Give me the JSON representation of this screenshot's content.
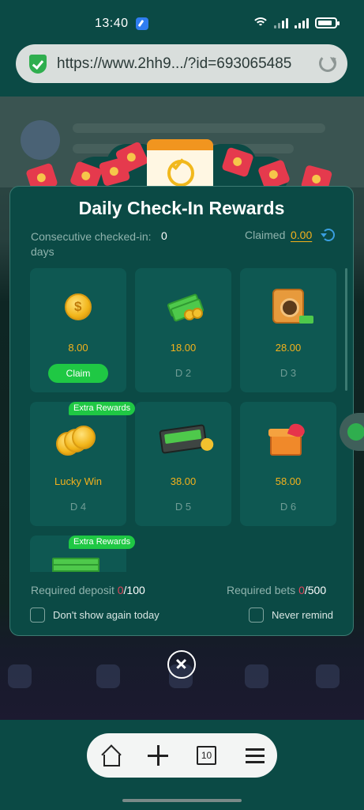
{
  "status_bar": {
    "time": "13:40"
  },
  "browser": {
    "url": "https://www.2hh9.../?id=693065485",
    "tab_count": "10"
  },
  "modal": {
    "title": "Daily Check-In Rewards",
    "consecutive_label": "Consecutive checked-in: days",
    "consecutive_value": "0",
    "claimed_label": "Claimed",
    "claimed_value": "0.00",
    "extra_rewards_label": "Extra Rewards",
    "cards": [
      {
        "amount": "8.00",
        "day": "",
        "action": "Claim",
        "icon": "gold-coin-icon",
        "extra": false
      },
      {
        "amount": "18.00",
        "day": "D 2",
        "action": "",
        "icon": "cash-coins-icon",
        "extra": false
      },
      {
        "amount": "28.00",
        "day": "D 3",
        "action": "",
        "icon": "safe-icon",
        "extra": false
      },
      {
        "amount": "Lucky Win",
        "day": "D 4",
        "action": "",
        "icon": "coin-stack-icon",
        "extra": true
      },
      {
        "amount": "38.00",
        "day": "D 5",
        "action": "",
        "icon": "cash-briefcase-icon",
        "extra": false
      },
      {
        "amount": "58.00",
        "day": "D 6",
        "action": "",
        "icon": "gift-box-icon",
        "extra": false
      },
      {
        "amount": "",
        "day": "",
        "action": "",
        "icon": "cash-stack-icon",
        "extra": true
      }
    ],
    "required_deposit_label": "Required deposit",
    "required_deposit_current": "0",
    "required_deposit_total": "/100",
    "required_bets_label": "Required bets",
    "required_bets_current": "0",
    "required_bets_total": "/500",
    "dont_show_label": "Don't show again today",
    "never_remind_label": "Never remind"
  },
  "colors": {
    "modal_bg": "#0b4a45",
    "card_bg": "#0e5852",
    "accent_gold": "#f3b11c",
    "claim_green": "#1fc844",
    "warning_red": "#e0455a"
  }
}
